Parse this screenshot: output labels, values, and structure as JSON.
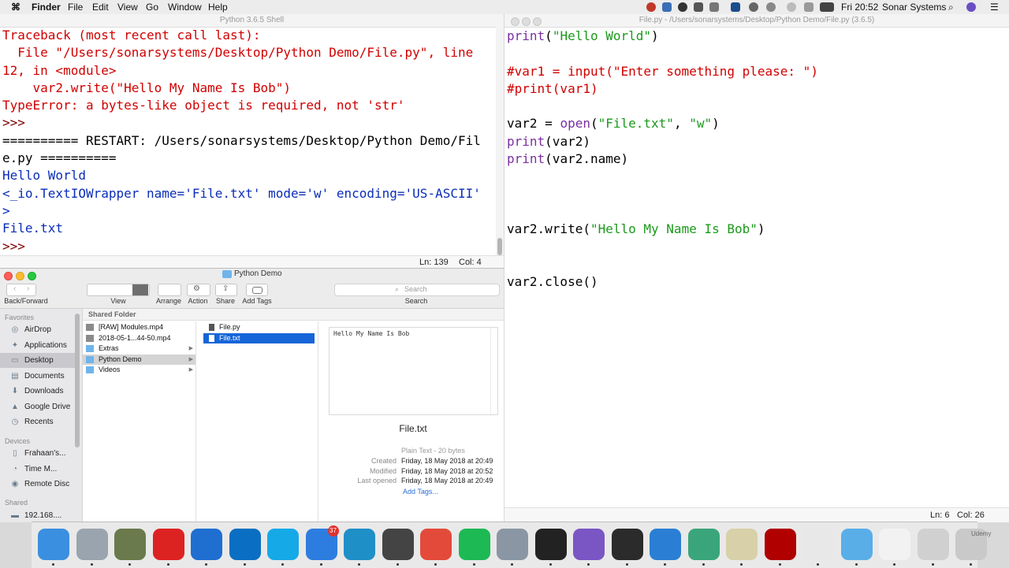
{
  "menubar": {
    "apple": "",
    "app": "Finder",
    "items": [
      "File",
      "Edit",
      "View",
      "Go",
      "Window",
      "Help"
    ],
    "clock": "Fri 20:52",
    "user": "Sonar Systems"
  },
  "shell": {
    "title": "Python 3.6.5 Shell",
    "lines": [
      {
        "text": "Traceback (most recent call last):",
        "color": "#d10000"
      },
      {
        "text": "  File \"/Users/sonarsystems/Desktop/Python Demo/File.py\", line",
        "color": "#d10000"
      },
      {
        "text": "12, in <module>",
        "color": "#d10000"
      },
      {
        "text": "    var2.write(\"Hello My Name Is Bob\")",
        "color": "#d10000"
      },
      {
        "text": "TypeError: a bytes-like object is required, not 'str'",
        "color": "#d10000"
      },
      {
        "text": ">>> ",
        "color": "#7a0000"
      },
      {
        "text": "========== RESTART: /Users/sonarsystems/Desktop/Python Demo/Fil",
        "color": "#000000"
      },
      {
        "text": "e.py ==========",
        "color": "#000000"
      },
      {
        "text": "Hello World",
        "color": "#0b2db8"
      },
      {
        "text": "<_io.TextIOWrapper name='File.txt' mode='w' encoding='US-ASCII'",
        "color": "#0b2db8"
      },
      {
        "text": ">",
        "color": "#0b2db8"
      },
      {
        "text": "File.txt",
        "color": "#0b2db8"
      },
      {
        "text": ">>> ",
        "color": "#7a0000"
      }
    ],
    "status_ln": "Ln: 139",
    "status_col": "Col: 4"
  },
  "editor": {
    "title": "File.py - /Users/sonarsystems/Desktop/Python Demo/File.py (3.6.5)",
    "lines": [
      {
        "segments": [
          {
            "t": "print",
            "c": "#7a2fa0"
          },
          {
            "t": "(",
            "c": "#000"
          },
          {
            "t": "\"Hello World\"",
            "c": "#1a9a1a"
          },
          {
            "t": ")",
            "c": "#000"
          }
        ]
      },
      {
        "segments": []
      },
      {
        "segments": [
          {
            "t": "#var1 = input(\"Enter something please: \")",
            "c": "#d10000"
          }
        ]
      },
      {
        "segments": [
          {
            "t": "#print(var1)",
            "c": "#d10000"
          }
        ]
      },
      {
        "segments": []
      },
      {
        "segments": [
          {
            "t": "var2 = ",
            "c": "#000"
          },
          {
            "t": "open",
            "c": "#7a2fa0"
          },
          {
            "t": "(",
            "c": "#000"
          },
          {
            "t": "\"File.txt\"",
            "c": "#1a9a1a"
          },
          {
            "t": ", ",
            "c": "#000"
          },
          {
            "t": "\"w\"",
            "c": "#1a9a1a"
          },
          {
            "t": ")",
            "c": "#000"
          }
        ]
      },
      {
        "segments": [
          {
            "t": "print",
            "c": "#7a2fa0"
          },
          {
            "t": "(var2)",
            "c": "#000"
          }
        ]
      },
      {
        "segments": [
          {
            "t": "print",
            "c": "#7a2fa0"
          },
          {
            "t": "(var2.name)",
            "c": "#000"
          }
        ]
      },
      {
        "segments": []
      },
      {
        "segments": []
      },
      {
        "segments": []
      },
      {
        "segments": [
          {
            "t": "var2.write(",
            "c": "#000"
          },
          {
            "t": "\"Hello My Name Is Bob\"",
            "c": "#1a9a1a"
          },
          {
            "t": ")",
            "c": "#000"
          }
        ]
      },
      {
        "segments": []
      },
      {
        "segments": []
      },
      {
        "segments": [
          {
            "t": "var2.close()",
            "c": "#000"
          }
        ]
      }
    ],
    "status_ln": "Ln: 6",
    "status_col": "Col: 26"
  },
  "finder": {
    "title": "Python Demo",
    "toolbar": {
      "back_forward": "Back/Forward",
      "view": "View",
      "arrange": "Arrange",
      "action": "Action",
      "share": "Share",
      "add_tags": "Add Tags",
      "search_placeholder": "Search",
      "search_label": "Search"
    },
    "sidebar": {
      "favorites_head": "Favorites",
      "favorites": [
        {
          "label": "AirDrop",
          "icon": "airdrop-icon",
          "glyph": "◎",
          "selected": false
        },
        {
          "label": "Applications",
          "icon": "applications-icon",
          "glyph": "✦",
          "selected": false
        },
        {
          "label": "Desktop",
          "icon": "desktop-icon",
          "glyph": "▭",
          "selected": true
        },
        {
          "label": "Documents",
          "icon": "documents-icon",
          "glyph": "▤",
          "selected": false
        },
        {
          "label": "Downloads",
          "icon": "downloads-icon",
          "glyph": "⬇",
          "selected": false
        },
        {
          "label": "Google Drive",
          "icon": "google-drive-icon",
          "glyph": "▲",
          "selected": false
        },
        {
          "label": "Recents",
          "icon": "recents-icon",
          "glyph": "◷",
          "selected": false
        }
      ],
      "devices_head": "Devices",
      "devices": [
        {
          "label": "Frahaan's...",
          "icon": "computer-icon",
          "glyph": "▯"
        },
        {
          "label": "Time M...",
          "icon": "time-machine-icon",
          "glyph": "◔"
        },
        {
          "label": "Remote Disc",
          "icon": "remote-disc-icon",
          "glyph": "◉"
        }
      ],
      "shared_head": "Shared",
      "shared": [
        {
          "label": "192.168....",
          "icon": "network-icon",
          "glyph": "▬"
        }
      ]
    },
    "column1_header": "Shared Folder",
    "column1": [
      {
        "label": "[RAW] Modules.mp4",
        "kind": "video",
        "arrow": ""
      },
      {
        "label": "2018-05-1...44-50.mp4",
        "kind": "video",
        "arrow": ""
      },
      {
        "label": "Extras",
        "kind": "folder",
        "arrow": "▶"
      },
      {
        "label": "Python Demo",
        "kind": "folder",
        "arrow": "▶",
        "selected": true
      },
      {
        "label": "Videos",
        "kind": "folder",
        "arrow": "▶"
      }
    ],
    "column2": [
      {
        "label": "File.py",
        "selected": false
      },
      {
        "label": "File.txt",
        "selected": true
      }
    ],
    "preview": {
      "content": "Hello My Name Is Bob",
      "filename": "File.txt",
      "kind": "Plain Text - 20 bytes",
      "created_label": "Created",
      "created": "Friday, 18 May 2018 at 20:49",
      "modified_label": "Modified",
      "modified": "Friday, 18 May 2018 at 20:52",
      "opened_label": "Last opened",
      "opened": "Friday, 18 May 2018 at 20:49",
      "add_tags": "Add Tags..."
    }
  },
  "dock": {
    "apps": [
      {
        "name": "finder-icon",
        "color": "#3b8fe0"
      },
      {
        "name": "launchpad-icon",
        "color": "#9aa4ae"
      },
      {
        "name": "preview-icon",
        "color": "#6a7a4c"
      },
      {
        "name": "sketchbook-icon",
        "color": "#d22"
      },
      {
        "name": "teamviewer-icon",
        "color": "#1e6fd0"
      },
      {
        "name": "trello-icon",
        "color": "#0a6fc2"
      },
      {
        "name": "skype-icon",
        "color": "#16a9e8"
      },
      {
        "name": "app-store-icon",
        "color": "#2d7de0",
        "badge": "37"
      },
      {
        "name": "screenflow-icon",
        "color": "#1f8fc8"
      },
      {
        "name": "sublime-text-icon",
        "color": "#444"
      },
      {
        "name": "chrome-icon",
        "color": "#e34a3a"
      },
      {
        "name": "spotify-icon",
        "color": "#1db954"
      },
      {
        "name": "system-preferences-icon",
        "color": "#8a96a3"
      },
      {
        "name": "obs-icon",
        "color": "#222"
      },
      {
        "name": "github-desktop-icon",
        "color": "#7a55c4"
      },
      {
        "name": "terminal-icon",
        "color": "#2b2b2b"
      },
      {
        "name": "safari-icon",
        "color": "#2a7fd4"
      },
      {
        "name": "atom-icon",
        "color": "#3aa57a"
      },
      {
        "name": "python-icon",
        "color": "#d8d0a8"
      },
      {
        "name": "acrobat-icon",
        "color": "#b00000"
      },
      {
        "name": "downloads-stack-icon",
        "color": "#e8e8e8"
      },
      {
        "name": "folder-stack-icon",
        "color": "#5aaee8"
      },
      {
        "name": "documents-stack-icon",
        "color": "#f2f2f2"
      },
      {
        "name": "screenshots-stack-icon",
        "color": "#d0d0d0"
      },
      {
        "name": "trash-icon",
        "color": "#c9c9c9"
      }
    ],
    "watermark": "Udemy"
  }
}
